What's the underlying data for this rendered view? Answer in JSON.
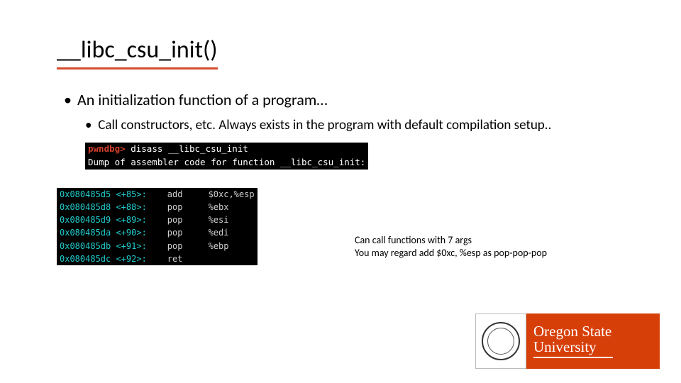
{
  "title": "__libc_csu_init()",
  "bullets": {
    "b1_text": "An initialization function of a program…",
    "b2_text": "Call constructors, etc. Always exists in the program with default compilation setup.."
  },
  "terminal": {
    "prompt": "pwndbg>",
    "cmd": " disass __libc_csu_init",
    "dump_line": "Dump of assembler code for function __libc_csu_init:"
  },
  "disasm_rows": [
    {
      "addr": "0x080485d5",
      "off": "<+85>:",
      "mnem": "add",
      "args": "$0xc,%esp"
    },
    {
      "addr": "0x080485d8",
      "off": "<+88>:",
      "mnem": "pop",
      "args": "%ebx"
    },
    {
      "addr": "0x080485d9",
      "off": "<+89>:",
      "mnem": "pop",
      "args": "%esi"
    },
    {
      "addr": "0x080485da",
      "off": "<+90>:",
      "mnem": "pop",
      "args": "%edi"
    },
    {
      "addr": "0x080485db",
      "off": "<+91>:",
      "mnem": "pop",
      "args": "%ebp"
    },
    {
      "addr": "0x080485dc",
      "off": "<+92>:",
      "mnem": "ret",
      "args": ""
    }
  ],
  "note": {
    "line1": "Can call functions with 7 args",
    "line2": "You may regard add $0xc, %esp as pop-pop-pop"
  },
  "logo": {
    "line1": "Oregon State",
    "line2": "University"
  }
}
